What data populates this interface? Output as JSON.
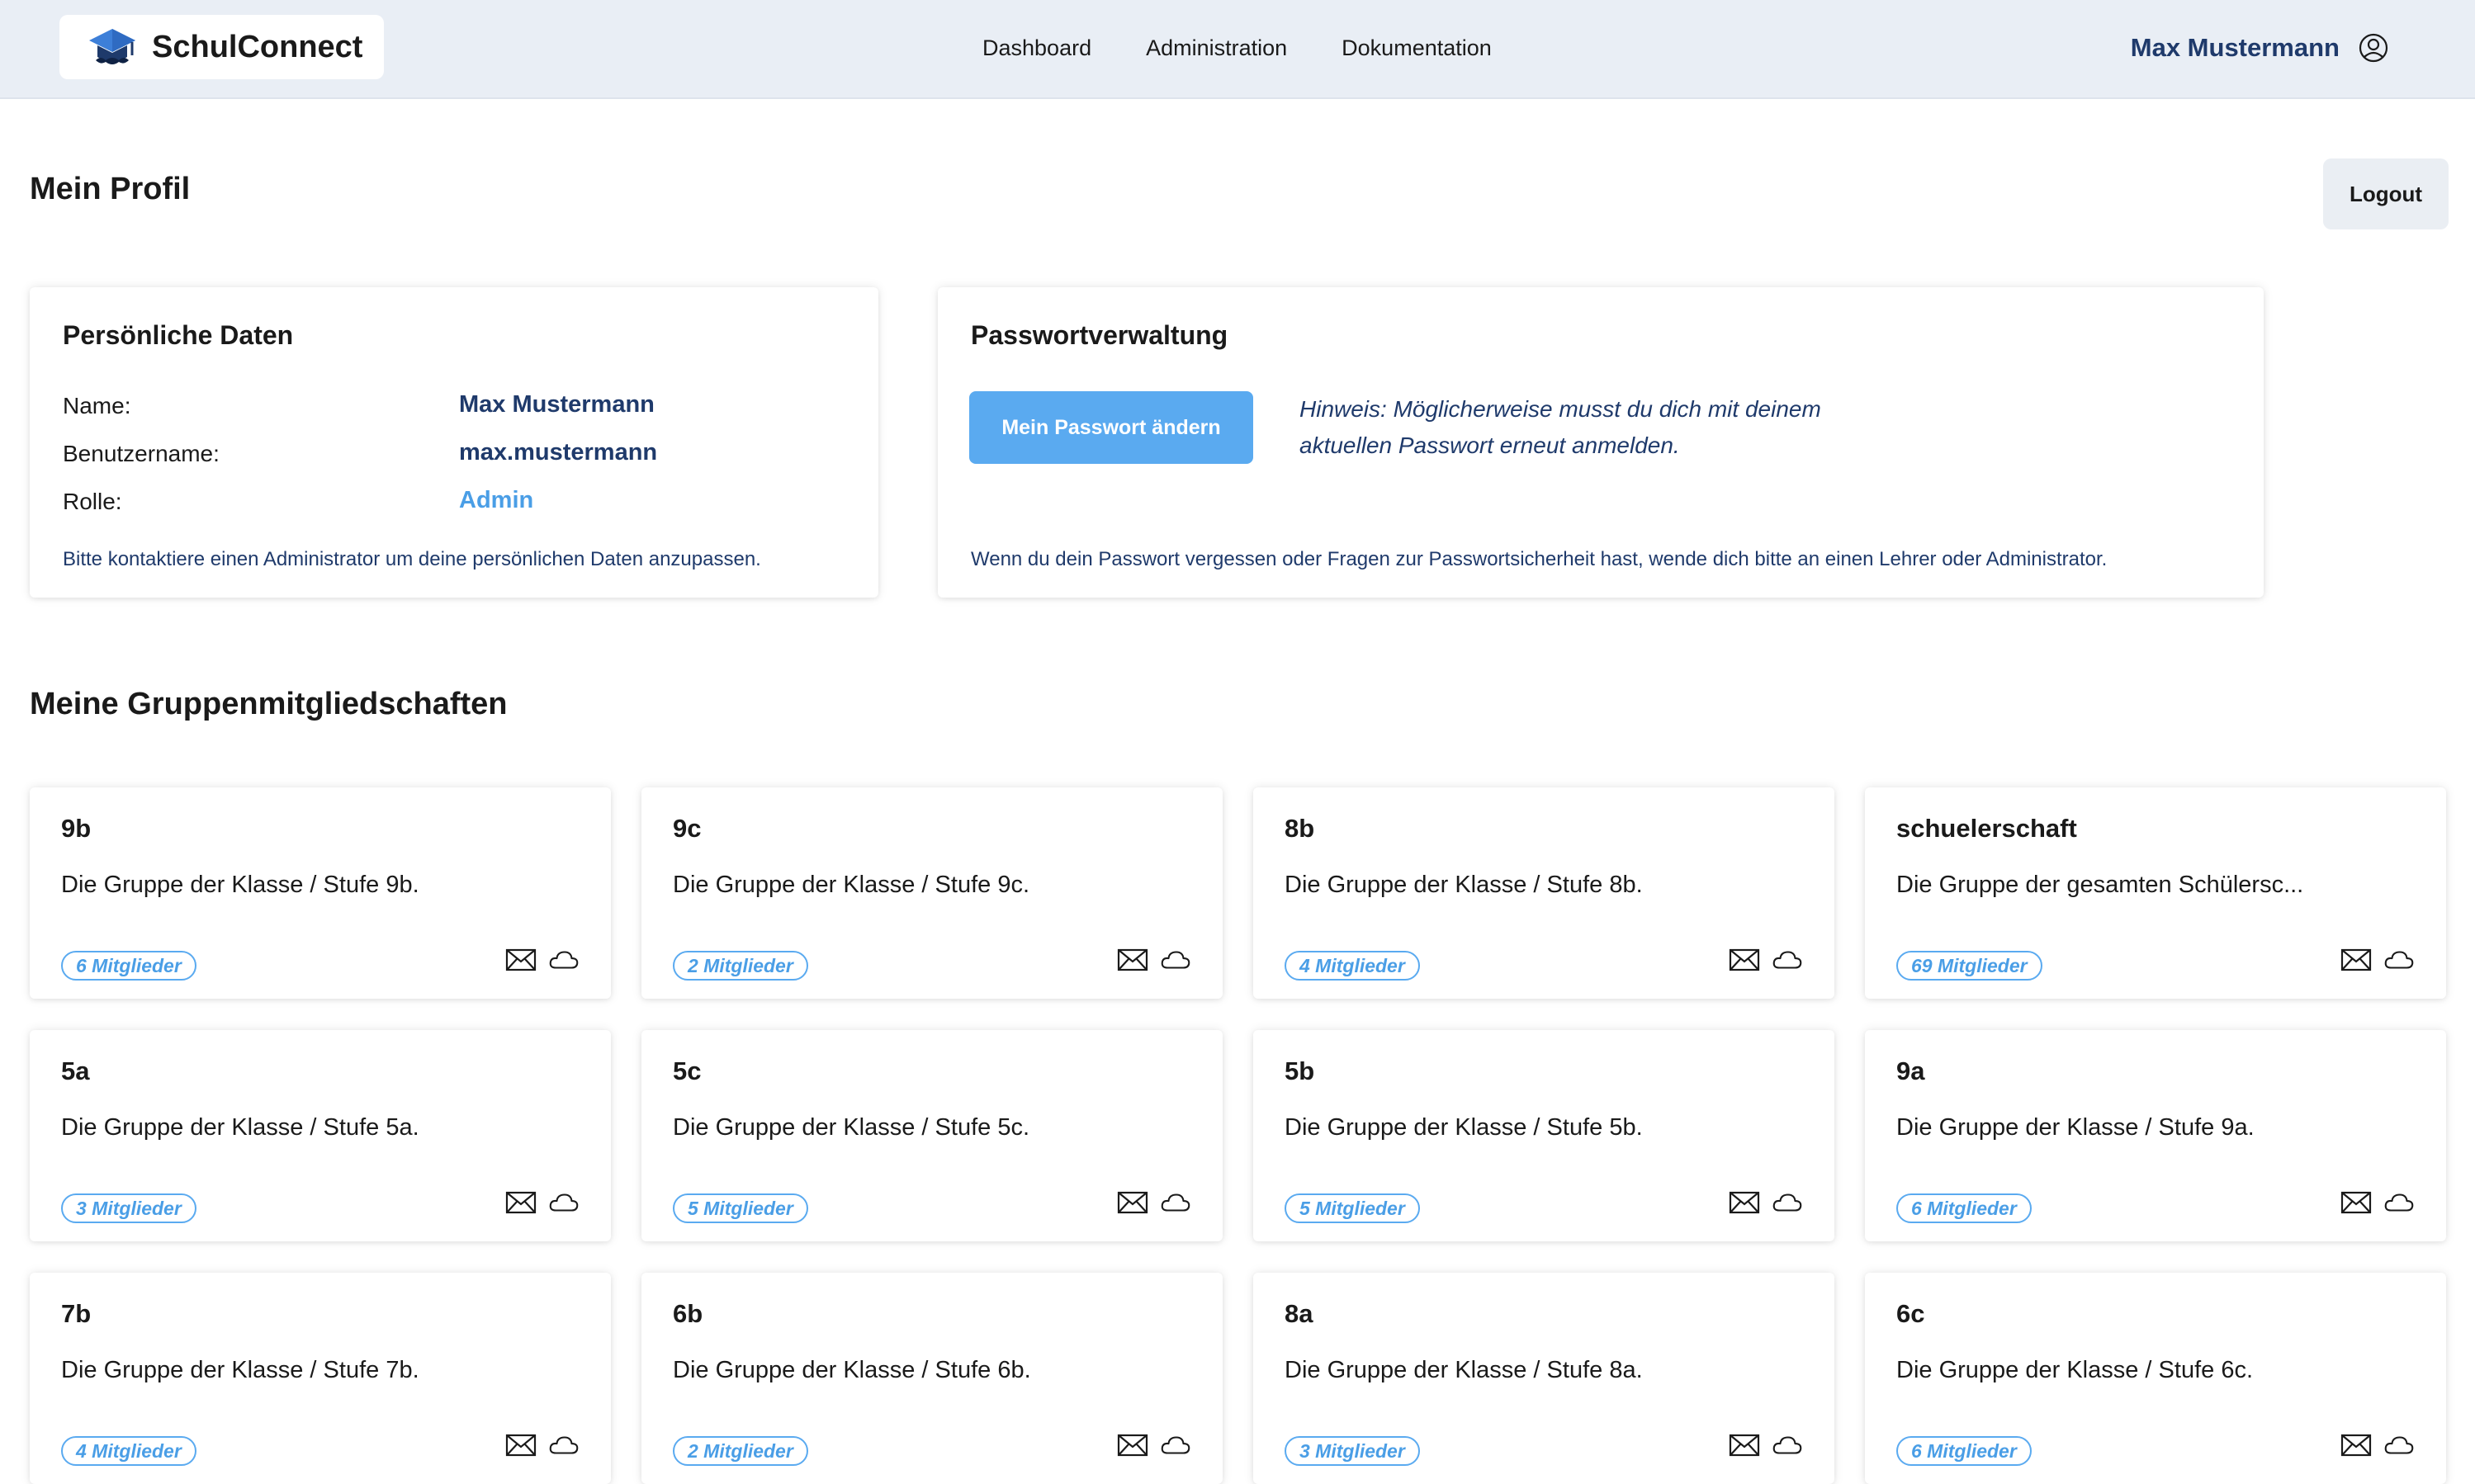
{
  "header": {
    "brand": "SchulConnect",
    "nav": [
      "Dashboard",
      "Administration",
      "Dokumentation"
    ],
    "user_name": "Max Mustermann"
  },
  "page": {
    "title": "Mein Profil",
    "logout_label": "Logout"
  },
  "personal": {
    "title": "Persönliche Daten",
    "name_label": "Name:",
    "name_value": "Max Mustermann",
    "username_label": "Benutzername:",
    "username_value": "max.mustermann",
    "role_label": "Rolle:",
    "role_value": "Admin",
    "note": "Bitte kontaktiere einen Administrator um deine persönlichen Daten anzupassen."
  },
  "password": {
    "title": "Passwortverwaltung",
    "button_label": "Mein Passwort ändern",
    "hint_line1": "Hinweis: Möglicherweise musst du dich mit deinem",
    "hint_line2": "aktuellen Passwort erneut anmelden.",
    "note": "Wenn du dein Passwort vergessen oder Fragen zur Passwortsicherheit hast, wende dich bitte an einen Lehrer oder Administrator."
  },
  "groups_section": {
    "title": "Meine Gruppenmitgliedschaften",
    "groups": [
      {
        "name": "9b",
        "description": "Die Gruppe der Klasse / Stufe 9b.",
        "members": "6 Mitglieder"
      },
      {
        "name": "9c",
        "description": "Die Gruppe der Klasse / Stufe 9c.",
        "members": "2 Mitglieder"
      },
      {
        "name": "8b",
        "description": "Die Gruppe der Klasse / Stufe 8b.",
        "members": "4 Mitglieder"
      },
      {
        "name": "schuelerschaft",
        "description": "Die Gruppe der gesamten Schülersc...",
        "members": "69 Mitglieder"
      },
      {
        "name": "5a",
        "description": "Die Gruppe der Klasse / Stufe 5a.",
        "members": "3 Mitglieder"
      },
      {
        "name": "5c",
        "description": "Die Gruppe der Klasse / Stufe 5c.",
        "members": "5 Mitglieder"
      },
      {
        "name": "5b",
        "description": "Die Gruppe der Klasse / Stufe 5b.",
        "members": "5 Mitglieder"
      },
      {
        "name": "9a",
        "description": "Die Gruppe der Klasse / Stufe 9a.",
        "members": "6 Mitglieder"
      },
      {
        "name": "7b",
        "description": "Die Gruppe der Klasse / Stufe 7b.",
        "members": "4 Mitglieder"
      },
      {
        "name": "6b",
        "description": "Die Gruppe der Klasse / Stufe 6b.",
        "members": "2 Mitglieder"
      },
      {
        "name": "8a",
        "description": "Die Gruppe der Klasse / Stufe 8a.",
        "members": "3 Mitglieder"
      },
      {
        "name": "6c",
        "description": "Die Gruppe der Klasse / Stufe 6c.",
        "members": "6 Mitglieder"
      }
    ]
  },
  "icons": {
    "logo": "graduation-cap-icon",
    "user": "user-circle-icon",
    "group_mail": "mail-icon",
    "group_cloud": "cloud-icon"
  },
  "colors": {
    "header_bg": "#e9eef5",
    "accent": "#5aaaf0",
    "link_dark": "#1f3a6b",
    "role": "#4a9ee6"
  }
}
